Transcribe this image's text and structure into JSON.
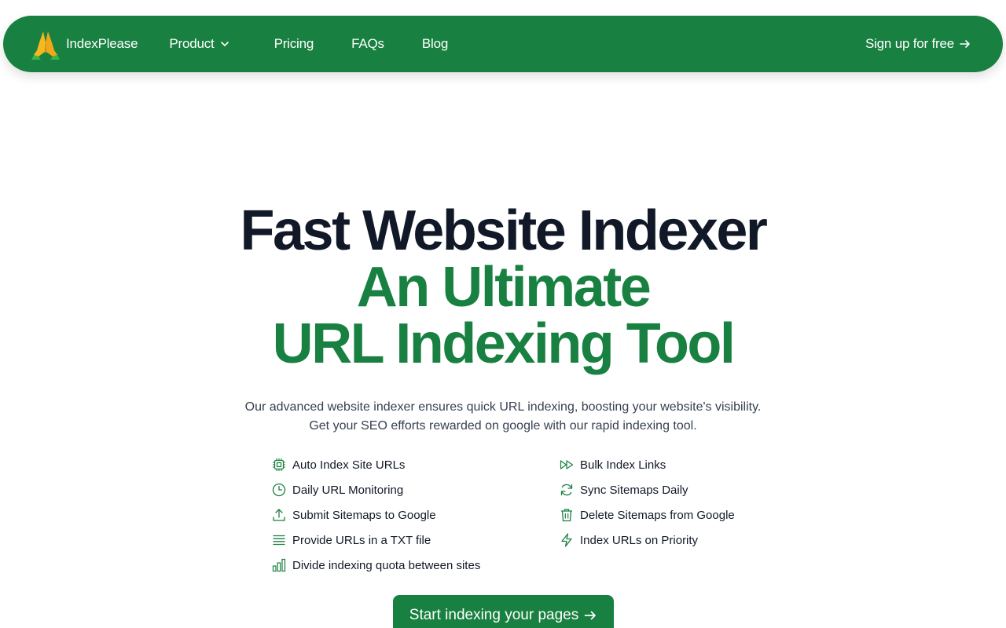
{
  "nav": {
    "brand_name": "IndexPlease",
    "links": [
      {
        "label": "Product",
        "has_dropdown": true
      },
      {
        "label": "Pricing"
      },
      {
        "label": "FAQs"
      },
      {
        "label": "Blog"
      }
    ],
    "signup_label": "Sign up for free",
    "bg_color": "#188040"
  },
  "hero": {
    "line1": "Fast Website Indexer",
    "line2": "An Ultimate",
    "line3": "URL Indexing Tool",
    "subtitle_line1": "Our advanced website indexer ensures quick URL indexing, boosting your website's visibility.",
    "subtitle_line2": "Get your SEO efforts rewarded on google with our rapid indexing tool."
  },
  "features": {
    "left": [
      {
        "label": "Auto Index Site URLs",
        "icon": "chip-icon"
      },
      {
        "label": "Daily URL Monitoring",
        "icon": "clock-icon"
      },
      {
        "label": "Submit Sitemaps to Google",
        "icon": "upload-icon"
      },
      {
        "label": "Provide URLs in a TXT file",
        "icon": "list-icon"
      },
      {
        "label": "Divide indexing quota between sites",
        "icon": "bar-chart-icon"
      }
    ],
    "right": [
      {
        "label": "Bulk Index Links",
        "icon": "fast-forward-icon"
      },
      {
        "label": "Sync Sitemaps Daily",
        "icon": "refresh-icon"
      },
      {
        "label": "Delete Sitemaps from Google",
        "icon": "trash-icon"
      },
      {
        "label": "Index URLs on Priority",
        "icon": "lightning-icon"
      }
    ]
  },
  "cta": {
    "label": "Start indexing your pages"
  },
  "colors": {
    "accent": "#188040",
    "heading": "#111827",
    "body_text": "#374151"
  }
}
